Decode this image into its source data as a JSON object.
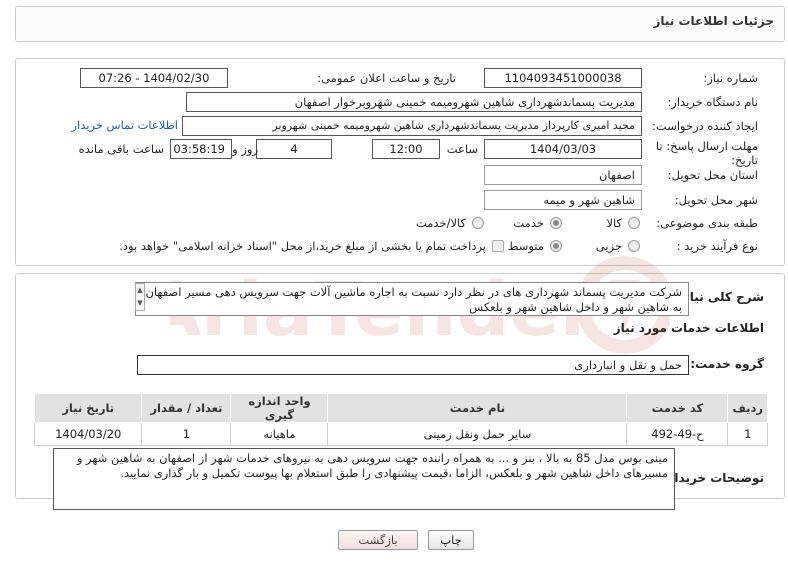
{
  "header": {
    "title": "جزئیات اطلاعات نیاز"
  },
  "form": {
    "need_number": {
      "label": "شماره نیاز:",
      "value": "1104093451000038"
    },
    "announce": {
      "label": "تاریخ و ساعت اعلان عمومی:",
      "value": "1404/02/30 - 07:26"
    },
    "buyer_org": {
      "label": "نام دستگاه خریدار:",
      "value": "مدیریت پسماندشهرداری شاهین شهرومیمه خمینی شهروبرخوار اصفهان"
    },
    "creator": {
      "label": "ایجاد کننده درخواست:",
      "value": "مجید امیری کارپرداز مدیریت پسماندشهرداری شاهین شهرومیمه خمینی شهروبر",
      "contact_link": "اطلاعات تماس خریدار"
    },
    "deadline": {
      "label_line1": "مهلت ارسال پاسخ: تا",
      "label_line2": "تاریخ:",
      "date": "1404/03/03",
      "time_label": "ساعت",
      "time": "12:00",
      "days": "4",
      "days_label": "روز و",
      "remaining": "03:58:19",
      "remaining_label": "ساعت باقی مانده"
    },
    "province": {
      "label": "استان محل تحویل:",
      "value": "اصفهان"
    },
    "city": {
      "label": "شهر محل تحویل:",
      "value": "شاهین شهر و میمه"
    },
    "category": {
      "label": "طبقه بندی موضوعی:",
      "options": [
        "کالا",
        "خدمت",
        "کالا/خدمت"
      ],
      "selected": "خدمت"
    },
    "process": {
      "label": "نوع فرآیند خرید :",
      "options": [
        "جزیی",
        "متوسط"
      ],
      "selected": "متوسط",
      "payment_note": "پرداخت تمام یا بخشی از مبلغ خرید،از محل \"اسناد خزانه اسلامی\" خواهد بود."
    }
  },
  "details": {
    "summary_label": "شرح کلی نیاز:",
    "summary_value": "شرکت مدیریت پسماند شهرداری های در نظر دارد نسبت به اجاره ماشین آلات جهت سرویس دهی مسیر اصفهان به شاهین شهر و داخل شاهین شهر و بلعکس",
    "services_title": "اطلاعات خدمات مورد نیاز",
    "service_group_label": "گروه خدمت:",
    "service_group_value": "حمل و نقل و انبارداری",
    "table": {
      "headers": [
        "ردیف",
        "کد خدمت",
        "نام خدمت",
        "واحد اندازه گیری",
        "تعداد / مقدار",
        "تاریخ نیاز"
      ],
      "rows": [
        [
          "1",
          "ح-49-492",
          "سایر حمل ونقل زمینی",
          "ماهیانه",
          "1",
          "1404/03/20"
        ]
      ]
    },
    "buyer_notes_label": "توضیحات خریدار:",
    "buyer_notes_value": "مینی بوس مدل 85 به بالا ، بنز و ... به همراه راننده جهت سرویس دهی به نیروهای خدمات شهر از اصفهان به شاهین شهر و مسیرهای داخل شاهین شهر و بلعکس، الزاما ،قیمت پیشنهادی را طبق استعلام بها پیوست تکمیل و بار گذاری نمایید."
  },
  "buttons": {
    "print": "چاپ",
    "back": "بازگشت"
  },
  "colors": {
    "link": "#1a5fb4",
    "table_header": "#e2e2e2",
    "border": "#c9c9c9"
  }
}
